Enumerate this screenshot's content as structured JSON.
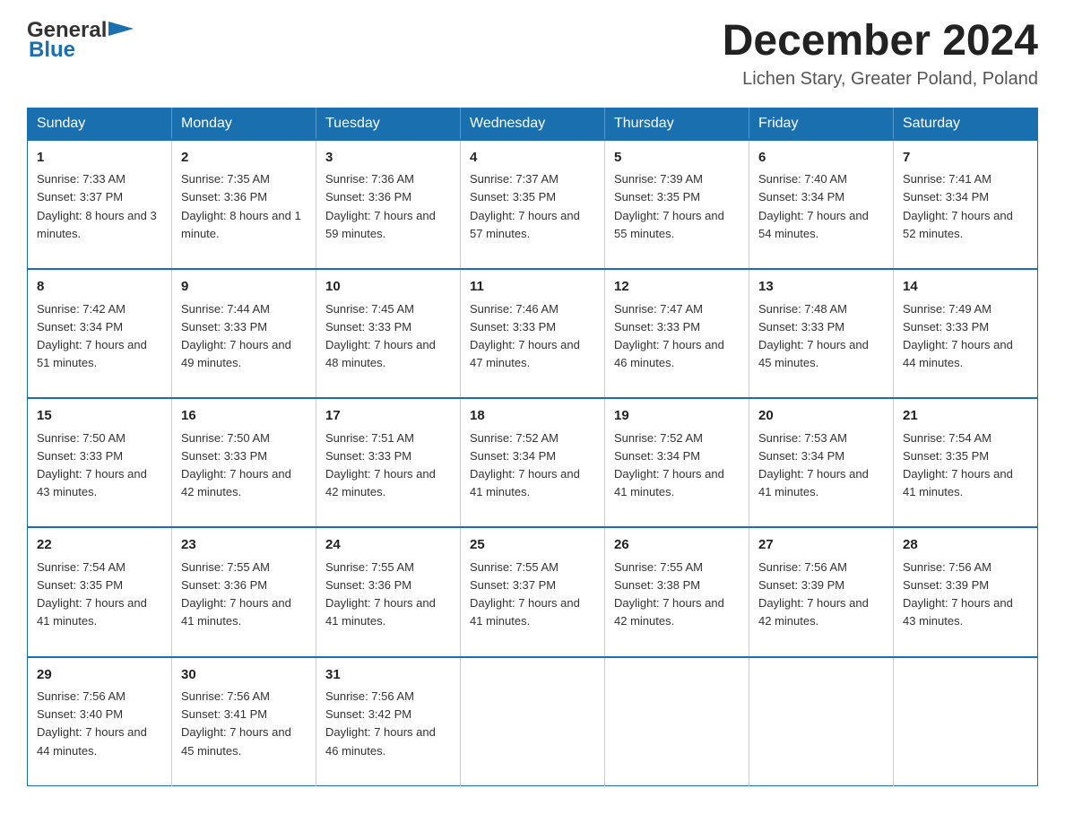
{
  "header": {
    "logo_general": "General",
    "logo_blue": "Blue",
    "month_title": "December 2024",
    "location": "Lichen Stary, Greater Poland, Poland"
  },
  "weekdays": [
    "Sunday",
    "Monday",
    "Tuesday",
    "Wednesday",
    "Thursday",
    "Friday",
    "Saturday"
  ],
  "weeks": [
    [
      {
        "day": "1",
        "sunrise": "7:33 AM",
        "sunset": "3:37 PM",
        "daylight": "8 hours and 3 minutes."
      },
      {
        "day": "2",
        "sunrise": "7:35 AM",
        "sunset": "3:36 PM",
        "daylight": "8 hours and 1 minute."
      },
      {
        "day": "3",
        "sunrise": "7:36 AM",
        "sunset": "3:36 PM",
        "daylight": "7 hours and 59 minutes."
      },
      {
        "day": "4",
        "sunrise": "7:37 AM",
        "sunset": "3:35 PM",
        "daylight": "7 hours and 57 minutes."
      },
      {
        "day": "5",
        "sunrise": "7:39 AM",
        "sunset": "3:35 PM",
        "daylight": "7 hours and 55 minutes."
      },
      {
        "day": "6",
        "sunrise": "7:40 AM",
        "sunset": "3:34 PM",
        "daylight": "7 hours and 54 minutes."
      },
      {
        "day": "7",
        "sunrise": "7:41 AM",
        "sunset": "3:34 PM",
        "daylight": "7 hours and 52 minutes."
      }
    ],
    [
      {
        "day": "8",
        "sunrise": "7:42 AM",
        "sunset": "3:34 PM",
        "daylight": "7 hours and 51 minutes."
      },
      {
        "day": "9",
        "sunrise": "7:44 AM",
        "sunset": "3:33 PM",
        "daylight": "7 hours and 49 minutes."
      },
      {
        "day": "10",
        "sunrise": "7:45 AM",
        "sunset": "3:33 PM",
        "daylight": "7 hours and 48 minutes."
      },
      {
        "day": "11",
        "sunrise": "7:46 AM",
        "sunset": "3:33 PM",
        "daylight": "7 hours and 47 minutes."
      },
      {
        "day": "12",
        "sunrise": "7:47 AM",
        "sunset": "3:33 PM",
        "daylight": "7 hours and 46 minutes."
      },
      {
        "day": "13",
        "sunrise": "7:48 AM",
        "sunset": "3:33 PM",
        "daylight": "7 hours and 45 minutes."
      },
      {
        "day": "14",
        "sunrise": "7:49 AM",
        "sunset": "3:33 PM",
        "daylight": "7 hours and 44 minutes."
      }
    ],
    [
      {
        "day": "15",
        "sunrise": "7:50 AM",
        "sunset": "3:33 PM",
        "daylight": "7 hours and 43 minutes."
      },
      {
        "day": "16",
        "sunrise": "7:50 AM",
        "sunset": "3:33 PM",
        "daylight": "7 hours and 42 minutes."
      },
      {
        "day": "17",
        "sunrise": "7:51 AM",
        "sunset": "3:33 PM",
        "daylight": "7 hours and 42 minutes."
      },
      {
        "day": "18",
        "sunrise": "7:52 AM",
        "sunset": "3:34 PM",
        "daylight": "7 hours and 41 minutes."
      },
      {
        "day": "19",
        "sunrise": "7:52 AM",
        "sunset": "3:34 PM",
        "daylight": "7 hours and 41 minutes."
      },
      {
        "day": "20",
        "sunrise": "7:53 AM",
        "sunset": "3:34 PM",
        "daylight": "7 hours and 41 minutes."
      },
      {
        "day": "21",
        "sunrise": "7:54 AM",
        "sunset": "3:35 PM",
        "daylight": "7 hours and 41 minutes."
      }
    ],
    [
      {
        "day": "22",
        "sunrise": "7:54 AM",
        "sunset": "3:35 PM",
        "daylight": "7 hours and 41 minutes."
      },
      {
        "day": "23",
        "sunrise": "7:55 AM",
        "sunset": "3:36 PM",
        "daylight": "7 hours and 41 minutes."
      },
      {
        "day": "24",
        "sunrise": "7:55 AM",
        "sunset": "3:36 PM",
        "daylight": "7 hours and 41 minutes."
      },
      {
        "day": "25",
        "sunrise": "7:55 AM",
        "sunset": "3:37 PM",
        "daylight": "7 hours and 41 minutes."
      },
      {
        "day": "26",
        "sunrise": "7:55 AM",
        "sunset": "3:38 PM",
        "daylight": "7 hours and 42 minutes."
      },
      {
        "day": "27",
        "sunrise": "7:56 AM",
        "sunset": "3:39 PM",
        "daylight": "7 hours and 42 minutes."
      },
      {
        "day": "28",
        "sunrise": "7:56 AM",
        "sunset": "3:39 PM",
        "daylight": "7 hours and 43 minutes."
      }
    ],
    [
      {
        "day": "29",
        "sunrise": "7:56 AM",
        "sunset": "3:40 PM",
        "daylight": "7 hours and 44 minutes."
      },
      {
        "day": "30",
        "sunrise": "7:56 AM",
        "sunset": "3:41 PM",
        "daylight": "7 hours and 45 minutes."
      },
      {
        "day": "31",
        "sunrise": "7:56 AM",
        "sunset": "3:42 PM",
        "daylight": "7 hours and 46 minutes."
      },
      null,
      null,
      null,
      null
    ]
  ],
  "labels": {
    "sunrise": "Sunrise:",
    "sunset": "Sunset:",
    "daylight": "Daylight:"
  }
}
